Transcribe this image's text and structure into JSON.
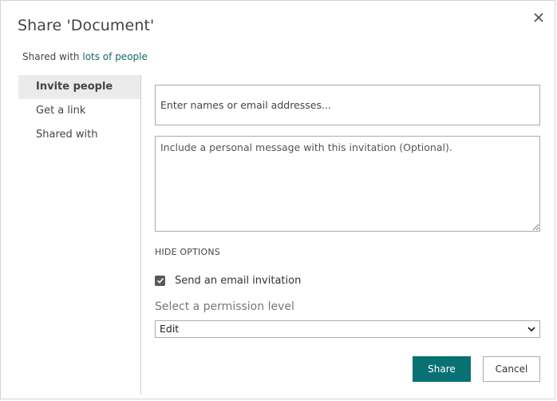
{
  "dialog": {
    "title": "Share 'Document'",
    "close_icon": "close-icon",
    "shared_with_prefix": "Shared with",
    "shared_with_link": "lots of people"
  },
  "sidebar": {
    "items": [
      {
        "label": "Invite people",
        "active": true
      },
      {
        "label": "Get a link",
        "active": false
      },
      {
        "label": "Shared with",
        "active": false
      }
    ]
  },
  "invite": {
    "names_placeholder": "Enter names or email addresses...",
    "names_value": "",
    "message_placeholder": "Include a personal message with this invitation (Optional).",
    "message_value": "",
    "hide_options_label": "HIDE OPTIONS",
    "send_email_label": "Send an email invitation",
    "send_email_checked": true,
    "permission_label": "Select a permission level",
    "permission_value": "Edit"
  },
  "buttons": {
    "share_label": "Share",
    "cancel_label": "Cancel"
  },
  "colors": {
    "accent": "#087173",
    "link": "#0f6a6b",
    "sidebar_active_bg": "#ebebeb"
  }
}
